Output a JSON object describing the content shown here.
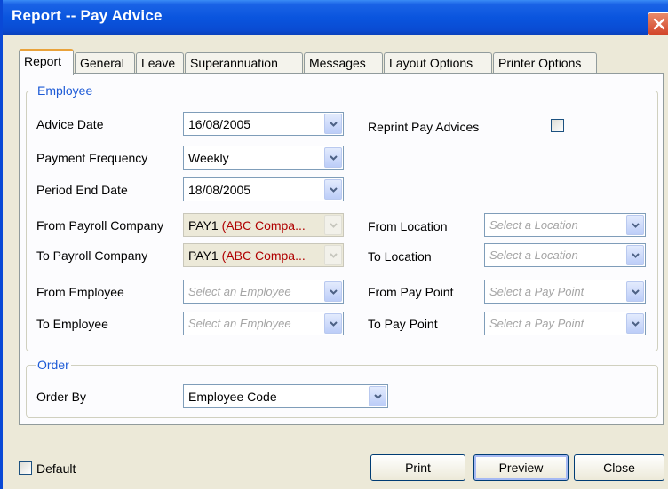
{
  "window": {
    "title": "Report -- Pay Advice"
  },
  "tabs": [
    "Report",
    "General",
    "Leave",
    "Superannuation",
    "Messages",
    "Layout Options",
    "Printer Options"
  ],
  "employee_group": {
    "legend": "Employee",
    "advice_date": {
      "label": "Advice Date",
      "value": "16/08/2005"
    },
    "payment_frequency": {
      "label": "Payment Frequency",
      "value": "Weekly"
    },
    "period_end_date": {
      "label": "Period End Date",
      "value": "18/08/2005"
    },
    "reprint": {
      "label": "Reprint Pay Advices",
      "checked": false
    },
    "from_payroll_company": {
      "label": "From Payroll Company",
      "code": "PAY1",
      "name": "(ABC Compa..."
    },
    "to_payroll_company": {
      "label": "To Payroll Company",
      "code": "PAY1",
      "name": "(ABC Compa..."
    },
    "from_location": {
      "label": "From Location",
      "placeholder": "Select a Location"
    },
    "to_location": {
      "label": "To Location",
      "placeholder": "Select a Location"
    },
    "from_employee": {
      "label": "From Employee",
      "placeholder": "Select an Employee"
    },
    "to_employee": {
      "label": "To Employee",
      "placeholder": "Select an Employee"
    },
    "from_pay_point": {
      "label": "From Pay Point",
      "placeholder": "Select a Pay Point"
    },
    "to_pay_point": {
      "label": "To Pay Point",
      "placeholder": "Select a Pay Point"
    }
  },
  "order_group": {
    "legend": "Order",
    "order_by": {
      "label": "Order By",
      "value": "Employee Code"
    }
  },
  "footer": {
    "default_label": "Default",
    "print_label": "Print",
    "preview_label": "Preview",
    "close_label": "Close"
  },
  "colors": {
    "title_bar": "#0a55de",
    "legend": "#1e5bd6",
    "company_name": "#b00000"
  }
}
